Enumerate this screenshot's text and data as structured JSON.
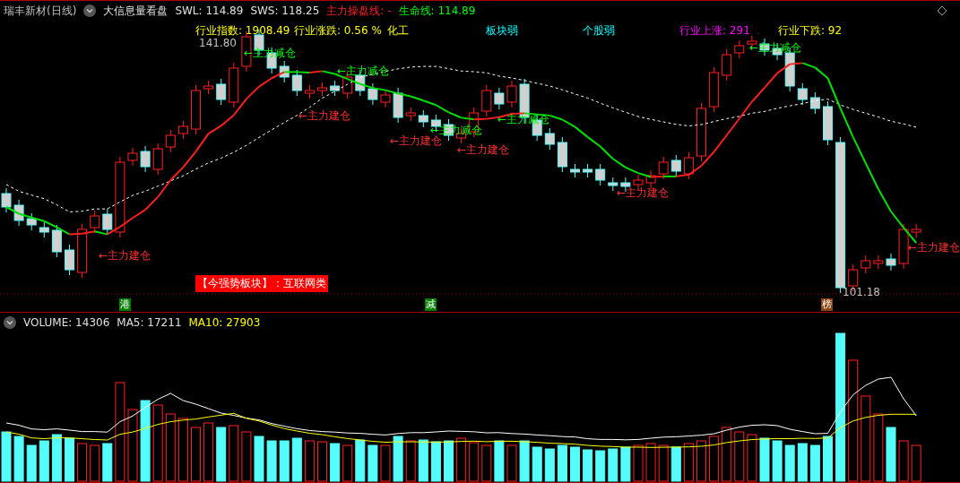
{
  "header": {
    "stock": "瑞丰新材(日线)",
    "indicator": "大信息量看盘",
    "swl": "SWL: 114.89",
    "sws": "SWS: 118.25",
    "main_line": "主力操盘线: -",
    "life_line": "生命线: 114.89"
  },
  "industry": {
    "index": "行业指数: 1908.49",
    "change": "行业涨跌: 0.56 %",
    "name": "化工",
    "sector_state": "板块弱",
    "stock_state": "个股弱",
    "up": "行业上涨: 291",
    "down": "行业下跌: 92"
  },
  "price_labels": {
    "high": "141.80",
    "low": "101.18"
  },
  "annotations": [
    {
      "text": "←主力减仓",
      "kind": "reduce"
    },
    {
      "text": "←主力减仓",
      "kind": "reduce"
    },
    {
      "text": "←主力建仓",
      "kind": "build"
    },
    {
      "text": "←主力减仓",
      "kind": "reduce"
    },
    {
      "text": "←主力减仓",
      "kind": "reduce"
    },
    {
      "text": "←主力建仓",
      "kind": "build"
    },
    {
      "text": "←主力建仓",
      "kind": "build"
    },
    {
      "text": "←主力建仓",
      "kind": "build"
    },
    {
      "text": "←主力建仓",
      "kind": "build"
    },
    {
      "text": "←主力建仓",
      "kind": "build"
    },
    {
      "text": "←主力减仓",
      "kind": "reduce"
    }
  ],
  "banner": "【今强势板块】：互联网类",
  "signals": [
    {
      "text": "港",
      "color": "#008000"
    },
    {
      "text": "减",
      "color": "#008000"
    },
    {
      "text": "榜",
      "color": "#8b4513"
    }
  ],
  "volume": {
    "volume": "VOLUME: 14306",
    "ma5": "MA5: 17211",
    "ma10": "MA10: 27903"
  }
}
